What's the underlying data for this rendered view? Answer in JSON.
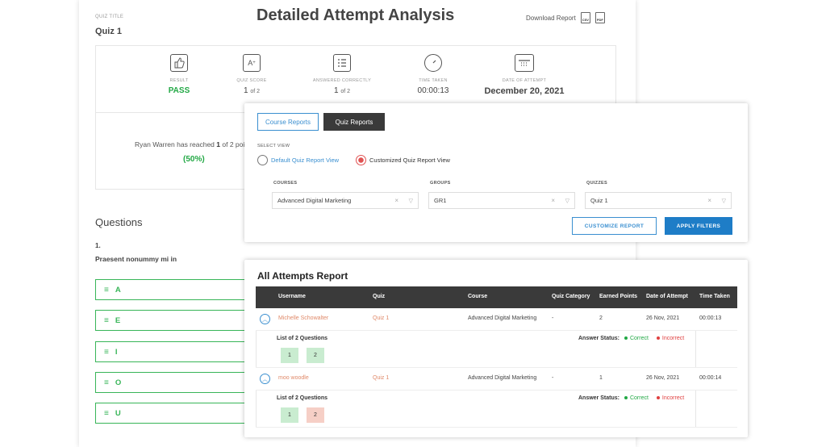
{
  "analysis": {
    "quiz_title_label": "QUIZ TITLE",
    "quiz_title": "Quiz 1",
    "page_title": "Detailed Attempt Analysis",
    "download_label": "Download Report",
    "download_icons": [
      "CSV",
      "PDF"
    ],
    "stats": [
      {
        "icon": "thumbs-up-icon",
        "label": "RESULT",
        "value": "PASS"
      },
      {
        "icon": "score-icon",
        "label": "QUIZ SCORE",
        "value": "1",
        "suffix": "of 2"
      },
      {
        "icon": "checklist-icon",
        "label": "ANSWERED CORRECTLY",
        "value": "1",
        "suffix": "of 2"
      },
      {
        "icon": "stopwatch-icon",
        "label": "TIME TAKEN",
        "value": "00:00:13"
      },
      {
        "icon": "calendar-icon",
        "label": "DATE OF ATTEMPT",
        "value": "December 20, 2021"
      }
    ],
    "reached_prefix": "Ryan Warren has reached",
    "reached_points": "1",
    "reached_suffix": "of 2 poi",
    "reached_pct": "(50%)",
    "questions_heading": "Questions",
    "question_number": "1.",
    "question_text": "Praesent nonummy mi in",
    "answers": [
      "A",
      "E",
      "I",
      "O",
      "U"
    ],
    "colors": {
      "pass": "#22a845",
      "answer_border": "#38b558"
    }
  },
  "filters": {
    "tabs": [
      "Course Reports",
      "Quiz Reports"
    ],
    "select_view_label": "SELECT VIEW",
    "view_options": [
      "Default Quiz Report View",
      "Customized Quiz Report View"
    ],
    "selected_view": "Customized Quiz Report View",
    "fields": [
      {
        "label": "COURSES",
        "value": "Advanced Digital Marketing"
      },
      {
        "label": "GROUPS",
        "value": "GR1"
      },
      {
        "label": "QUIZZES",
        "value": "Quiz 1"
      }
    ],
    "customize_label": "CUSTOMIZE REPORT",
    "apply_label": "APPLY FILTERS",
    "colors": {
      "accent": "#1e7dc7",
      "active_tab": "#3a3a3a"
    }
  },
  "report": {
    "title": "All Attempts Report",
    "columns": [
      "Username",
      "Quiz",
      "Course",
      "Quiz Category",
      "Earned Points",
      "Date of Attempt",
      "Time Taken"
    ],
    "rows": [
      {
        "username": "Michelle Schowalter",
        "quiz": "Quiz 1",
        "course": "Advanced Digital Marketing",
        "category": "-",
        "points": "2",
        "date": "26 Nov, 2021",
        "time": "00:00:13",
        "list_label": "List of 2 Questions",
        "questions": [
          {
            "n": "1",
            "status": "correct"
          },
          {
            "n": "2",
            "status": "correct"
          }
        ]
      },
      {
        "username": "moo woodle",
        "quiz": "Quiz 1",
        "course": "Advanced Digital Marketing",
        "category": "-",
        "points": "1",
        "date": "26 Nov, 2021",
        "time": "00:00:14",
        "list_label": "List of 2 Questions",
        "questions": [
          {
            "n": "1",
            "status": "correct"
          },
          {
            "n": "2",
            "status": "incorrect"
          }
        ]
      }
    ],
    "answer_status_label": "Answer Status:",
    "correct_label": "Correct",
    "incorrect_label": "Incorrect",
    "colors": {
      "header_bg": "#3a3a3a",
      "correct": "#22a845",
      "incorrect": "#e04040",
      "link": "#e08a6a"
    }
  }
}
